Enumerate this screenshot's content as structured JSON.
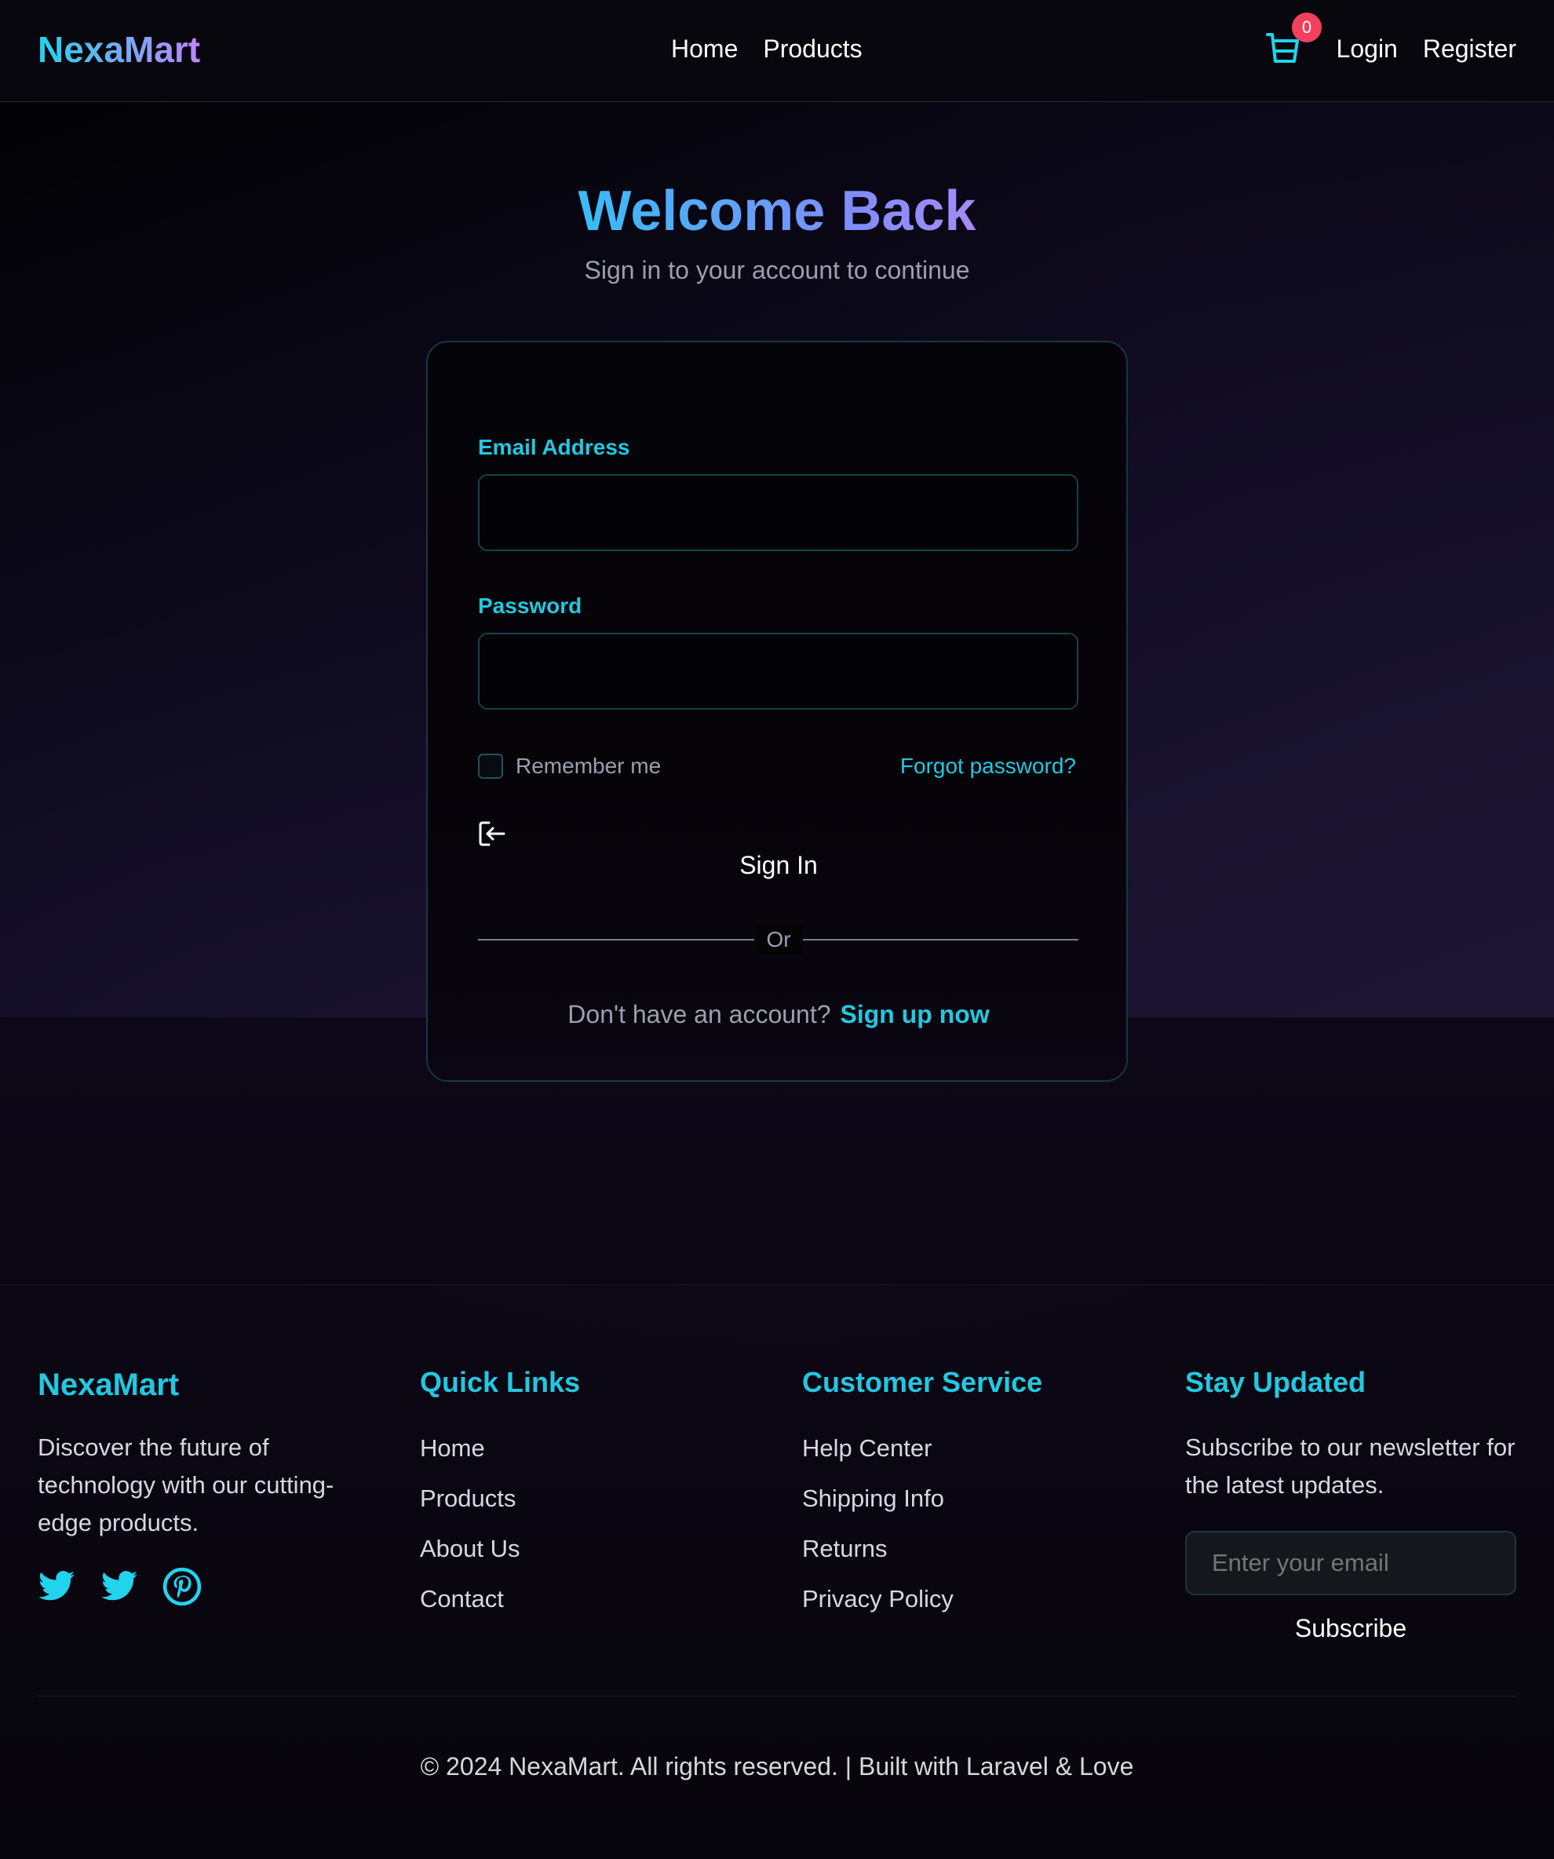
{
  "nav": {
    "brand": "NexaMart",
    "links": [
      "Home",
      "Products"
    ],
    "cart_count": "0",
    "login": "Login",
    "register": "Register"
  },
  "hero": {
    "title": "Welcome Back",
    "subtitle": "Sign in to your account to continue"
  },
  "form": {
    "email_label": "Email Address",
    "email_value": "",
    "password_label": "Password",
    "password_value": "",
    "remember_label": "Remember me",
    "remember_checked": false,
    "forgot_label": "Forgot password?",
    "signin_label": "Sign In",
    "divider_label": "Or",
    "signup_prompt": "Don't have an account?",
    "signup_link": "Sign up now"
  },
  "footer": {
    "brand": "NexaMart",
    "about": "Discover the future of technology with our cutting-edge products.",
    "social_icons": [
      "twitter-icon",
      "twitter-icon",
      "pinterest-icon"
    ],
    "quick_links": {
      "heading": "Quick Links",
      "items": [
        "Home",
        "Products",
        "About Us",
        "Contact"
      ]
    },
    "customer_service": {
      "heading": "Customer Service",
      "items": [
        "Help Center",
        "Shipping Info",
        "Returns",
        "Privacy Policy"
      ]
    },
    "newsletter": {
      "heading": "Stay Updated",
      "text": "Subscribe to our newsletter for the latest updates.",
      "placeholder": "Enter your email",
      "button": "Subscribe"
    },
    "copyright": "© 2024 NexaMart. All rights reserved. | Built with Laravel & Love"
  },
  "colors": {
    "accent": "#22c8e0",
    "badge": "#f43f5e",
    "brand_gradient_end": "#c084fc"
  }
}
